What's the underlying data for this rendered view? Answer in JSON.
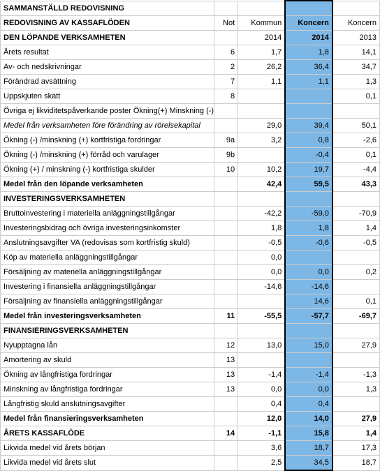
{
  "title": "SAMMANSTÄLLD REDOVISNING",
  "headers": {
    "row_label": "REDOVISNING AV KASSAFLÖDEN",
    "not": "Not",
    "c1": "Kommun",
    "c2": "Koncern",
    "c3": "Koncern"
  },
  "years": {
    "c1": "2014",
    "c2": "2014",
    "c3": "2013"
  },
  "section_op": "DEN LÖPANDE VERKSAMHETEN",
  "rows_op": [
    {
      "label": "Årets resultat",
      "not": "6",
      "c1": "1,7",
      "c2": "1,8",
      "c3": "14,1"
    },
    {
      "label": "Av- och nedskrivningar",
      "not": "2",
      "c1": "26,2",
      "c2": "36,4",
      "c3": "34,7"
    },
    {
      "label": "Förändrad avsättning",
      "not": "7",
      "c1": "1,1",
      "c2": "1,1",
      "c3": "1,3"
    },
    {
      "label": "Uppskjuten skatt",
      "not": "8",
      "c1": "",
      "c2": "",
      "c3": "0,1"
    },
    {
      "label": "Övriga ej likviditetspåverkande poster Ökning(+) Minskning (-)",
      "not": "",
      "c1": "",
      "c2": "",
      "c3": ""
    }
  ],
  "op_sub1": {
    "label": "Medel från verksamheten före förändring av rörelsekapital",
    "not": "",
    "c1": "29,0",
    "c2": "39,4",
    "c3": "50,1"
  },
  "rows_wc": [
    {
      "label": "Ökning (-) /minskning (+) kortfristiga fordringar",
      "not": "9a",
      "c1": "3,2",
      "c2": "0,8",
      "c3": "-2,6"
    },
    {
      "label": "Ökning (-) /minskning (+) förråd och varulager",
      "not": "9b",
      "c1": "",
      "c2": "-0,4",
      "c3": "0,1"
    },
    {
      "label": "Ökning (+) / minskning (-) kortfristiga skulder",
      "not": "10",
      "c1": "10,2",
      "c2": "19,7",
      "c3": "-4,4"
    }
  ],
  "op_total": {
    "label": "Medel från den löpande verksamheten",
    "not": "",
    "c1": "42,4",
    "c2": "59,5",
    "c3": "43,3"
  },
  "section_inv": "INVESTERINGSVERKSAMHETEN",
  "rows_inv": [
    {
      "label": "Bruttoinvestering i materiella anläggningstillgångar",
      "not": "",
      "c1": "-42,2",
      "c2": "-59,0",
      "c3": "-70,9"
    },
    {
      "label": "Investeringsbidrag och övriga investeringsinkomster",
      "not": "",
      "c1": "1,8",
      "c2": "1,8",
      "c3": "1,4"
    },
    {
      "label": "Anslutningsavgifter VA (redovisas som kortfristig skuld)",
      "not": "",
      "c1": "-0,5",
      "c2": "-0,6",
      "c3": "-0,5"
    },
    {
      "label": "Köp av  materiella anläggningstillgångar",
      "not": "",
      "c1": "0,0",
      "c2": "",
      "c3": ""
    },
    {
      "label": "Försäljning av materiella anläggningstillgångar",
      "not": "",
      "c1": "0,0",
      "c2": "0,0",
      "c3": "0,2"
    },
    {
      "label": "Investering i finansiella anläggningstillgångar",
      "not": "",
      "c1": "-14,6",
      "c2": "-14,6",
      "c3": ""
    },
    {
      "label": "Försäljning av finansiella anläggningstillgångar",
      "not": "",
      "c1": "",
      "c2": "14,6",
      "c3": "0,1"
    }
  ],
  "inv_total": {
    "label": "Medel från investeringsverksamheten",
    "not": "11",
    "c1": "-55,5",
    "c2": "-57,7",
    "c3": "-69,7"
  },
  "section_fin": "FINANSIERINGSVERKSAMHETEN",
  "rows_fin": [
    {
      "label": "Nyupptagna lån",
      "not": "12",
      "c1": "13,0",
      "c2": "15,0",
      "c3": "27,9"
    },
    {
      "label": "Amortering av skuld",
      "not": "13",
      "c1": "",
      "c2": "",
      "c3": ""
    },
    {
      "label": "Ökning av långfristiga fordringar",
      "not": "13",
      "c1": "-1,4",
      "c2": "-1,4",
      "c3": "-1,3"
    },
    {
      "label": "Minskning av långfristiga fordringar",
      "not": "13",
      "c1": "0,0",
      "c2": "0,0",
      "c3": "1,3"
    },
    {
      "label": "Långfristig skuld anslutningsavgifter",
      "not": "",
      "c1": "0,4",
      "c2": "0,4",
      "c3": ""
    }
  ],
  "fin_total": {
    "label": "Medel från finansieringsverksamheten",
    "not": "",
    "c1": "12,0",
    "c2": "14,0",
    "c3": "27,9"
  },
  "year_total": {
    "label": "ÅRETS KASSAFLÖDE",
    "not": "14",
    "c1": "-1,1",
    "c2": "15,8",
    "c3": "1,4"
  },
  "liq_start": {
    "label": "Likvida medel vid årets början",
    "not": "",
    "c1": "3,6",
    "c2": "18,7",
    "c3": "17,3"
  },
  "liq_end": {
    "label": "Likvida medel vid årets slut",
    "not": "",
    "c1": "2,5",
    "c2": "34,5",
    "c3": "18,7"
  }
}
